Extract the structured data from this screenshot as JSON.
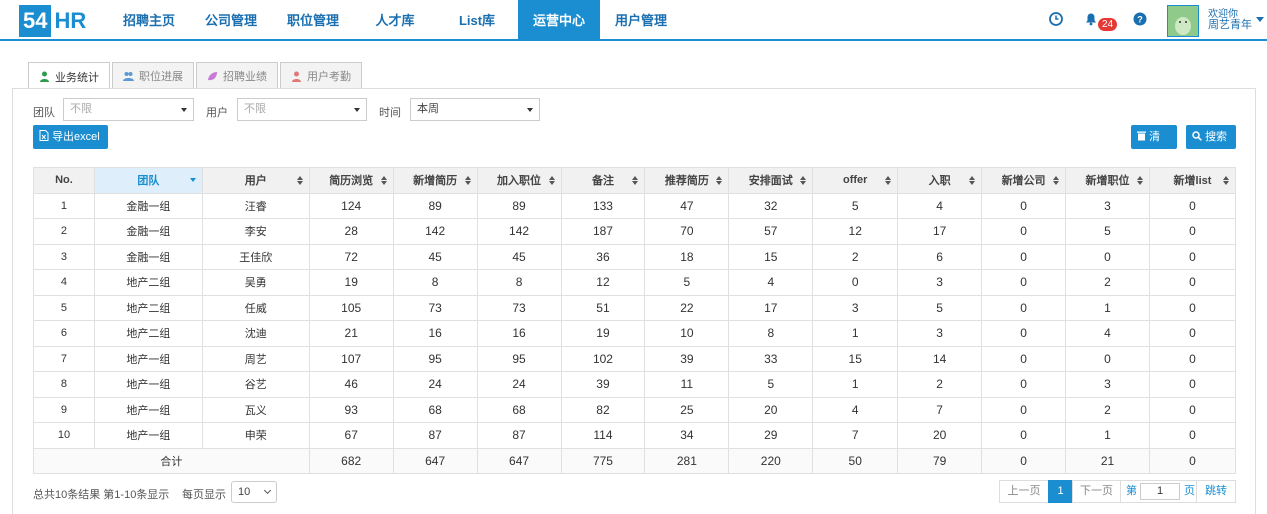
{
  "logo": {
    "num": "54",
    "text": "HR"
  },
  "nav": [
    {
      "label": "招聘主页"
    },
    {
      "label": "公司管理"
    },
    {
      "label": "职位管理"
    },
    {
      "label": "人才库"
    },
    {
      "label": "List库"
    },
    {
      "label": "运营中心",
      "active": true
    },
    {
      "label": "用户管理"
    }
  ],
  "user": {
    "welcome": "欢迎你",
    "name": "周艺青年",
    "notifications": "24"
  },
  "tabs": [
    {
      "label": "业务统计",
      "active": true
    },
    {
      "label": "职位进展"
    },
    {
      "label": "招聘业绩"
    },
    {
      "label": "用户考勤"
    }
  ],
  "filters": {
    "team_label": "团队",
    "team_value": "不限",
    "user_label": "用户",
    "user_value": "不限",
    "time_label": "时间",
    "time_value": "本周"
  },
  "buttons": {
    "export": "导出excel",
    "clear": "清空",
    "search": "搜索"
  },
  "table": {
    "headers": [
      "No.",
      "团队",
      "用户",
      "简历浏览",
      "新增简历",
      "加入职位",
      "备注",
      "推荐简历",
      "安排面试",
      "offer",
      "入职",
      "新增公司",
      "新增职位",
      "新增list"
    ],
    "rows": [
      [
        "1",
        "金融一组",
        "汪睿",
        "124",
        "89",
        "89",
        "133",
        "47",
        "32",
        "5",
        "4",
        "0",
        "3",
        "0"
      ],
      [
        "2",
        "金融一组",
        "李安",
        "28",
        "142",
        "142",
        "187",
        "70",
        "57",
        "12",
        "17",
        "0",
        "5",
        "0"
      ],
      [
        "3",
        "金融一组",
        "王佳欣",
        "72",
        "45",
        "45",
        "36",
        "18",
        "15",
        "2",
        "6",
        "0",
        "0",
        "0"
      ],
      [
        "4",
        "地产二组",
        "吴勇",
        "19",
        "8",
        "8",
        "12",
        "5",
        "4",
        "0",
        "3",
        "0",
        "2",
        "0"
      ],
      [
        "5",
        "地产二组",
        "任威",
        "105",
        "73",
        "73",
        "51",
        "22",
        "17",
        "3",
        "5",
        "0",
        "1",
        "0"
      ],
      [
        "6",
        "地产二组",
        "沈迪",
        "21",
        "16",
        "16",
        "19",
        "10",
        "8",
        "1",
        "3",
        "0",
        "4",
        "0"
      ],
      [
        "7",
        "地产一组",
        "周艺",
        "107",
        "95",
        "95",
        "102",
        "39",
        "33",
        "15",
        "14",
        "0",
        "0",
        "0"
      ],
      [
        "8",
        "地产一组",
        "谷艺",
        "46",
        "24",
        "24",
        "39",
        "11",
        "5",
        "1",
        "2",
        "0",
        "3",
        "0"
      ],
      [
        "9",
        "地产一组",
        "瓦义",
        "93",
        "68",
        "68",
        "82",
        "25",
        "20",
        "4",
        "7",
        "0",
        "2",
        "0"
      ],
      [
        "10",
        "地产一组",
        "申荣",
        "67",
        "87",
        "87",
        "114",
        "34",
        "29",
        "7",
        "20",
        "0",
        "1",
        "0"
      ]
    ],
    "total_label": "合计",
    "totals": [
      "682",
      "647",
      "647",
      "775",
      "281",
      "220",
      "50",
      "79",
      "0",
      "21",
      "0"
    ]
  },
  "footer": {
    "summary": "总共10条结果  第1-10条显示",
    "per_page_label": "每页显示",
    "per_page_value": "10",
    "prev": "上一页",
    "current": "1",
    "next": "下一页",
    "page_prefix": "第",
    "page_input": "1",
    "page_suffix": "页",
    "jump": "跳转"
  },
  "colors": {
    "primary": "#1a8ed1",
    "badge": "#e53935"
  }
}
